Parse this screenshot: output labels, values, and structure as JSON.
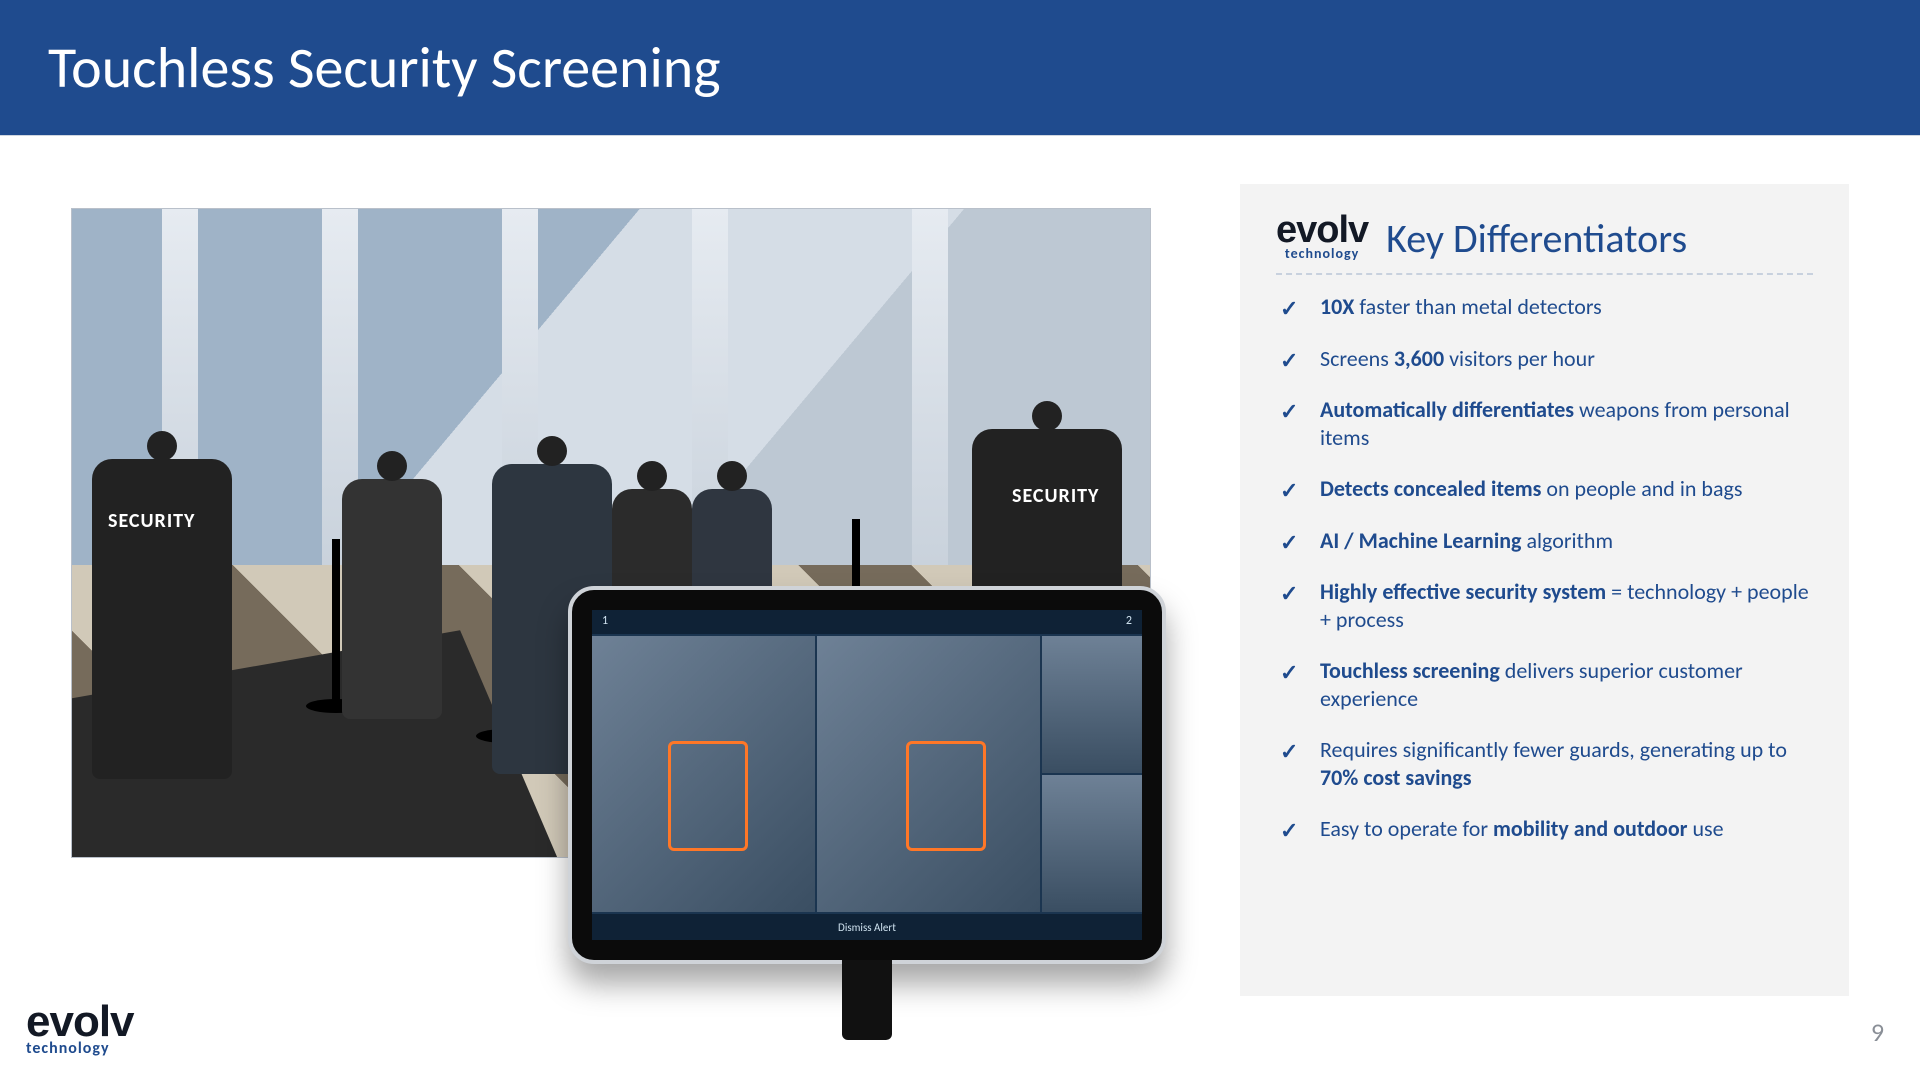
{
  "header": {
    "title": "Touchless Security Screening"
  },
  "brand": {
    "name": "evolv",
    "tagline": "technology"
  },
  "photo": {
    "guard_left_label": "SECURITY",
    "guard_right_label": "SECURITY"
  },
  "tablet": {
    "top_left": "1",
    "top_right": "2",
    "bottom_label": "Dismiss Alert"
  },
  "panel": {
    "title": "Key Differentiators",
    "items": [
      {
        "bold1": "10X",
        "text1": " faster than metal detectors"
      },
      {
        "text0": "Screens ",
        "bold1": "3,600",
        "text1": " visitors per hour"
      },
      {
        "bold1": "Automatically differentiates",
        "text1": " weapons from personal items"
      },
      {
        "bold1": "Detects concealed items",
        "text1": " on people and in bags"
      },
      {
        "bold1": "AI / Machine Learning",
        "text1": " algorithm"
      },
      {
        "bold1": "Highly effective security system",
        "text1": " = technology + people + process"
      },
      {
        "bold1": "Touchless screening",
        "text1": " delivers superior customer experience"
      },
      {
        "text0": "Requires significantly fewer guards, generating up to ",
        "bold1": "70% cost savings"
      },
      {
        "text0": "Easy to operate for ",
        "bold1": "mobility and outdoor",
        "text1": " use"
      }
    ]
  },
  "footer": {
    "page": "9"
  }
}
